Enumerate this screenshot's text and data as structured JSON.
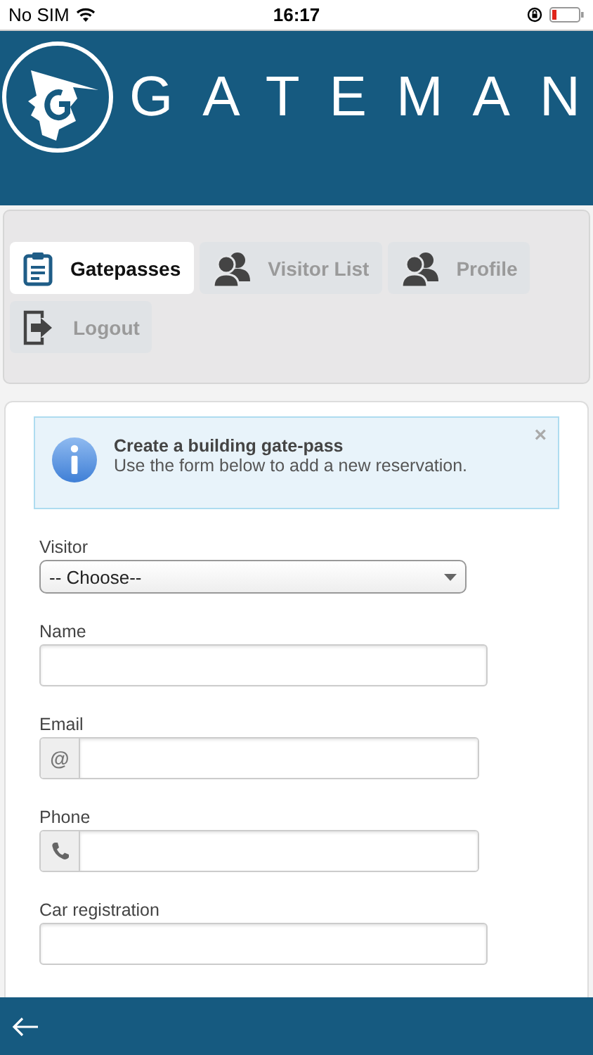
{
  "status_bar": {
    "carrier": "No SIM",
    "time": "16:17"
  },
  "header": {
    "logo_text": "GATEMAN"
  },
  "tabs": [
    {
      "label": "Gatepasses",
      "kind": "clipboard",
      "selected": true
    },
    {
      "label": "Visitor List",
      "kind": "people",
      "selected": false
    },
    {
      "label": "Profile",
      "kind": "people",
      "selected": false
    },
    {
      "label": "Logout",
      "kind": "exit",
      "selected": false
    }
  ],
  "alert": {
    "title": "Create a building gate-pass",
    "message": "Use the form below to add a new reservation.",
    "close": "×"
  },
  "fields": [
    {
      "label": "Visitor",
      "kind": "select",
      "value": "-- Choose--"
    },
    {
      "label": "Name",
      "kind": "text"
    },
    {
      "label": "Email",
      "kind": "addon",
      "addon": "@"
    },
    {
      "label": "Phone",
      "kind": "phone"
    },
    {
      "label": "Car registration",
      "kind": "text"
    }
  ]
}
